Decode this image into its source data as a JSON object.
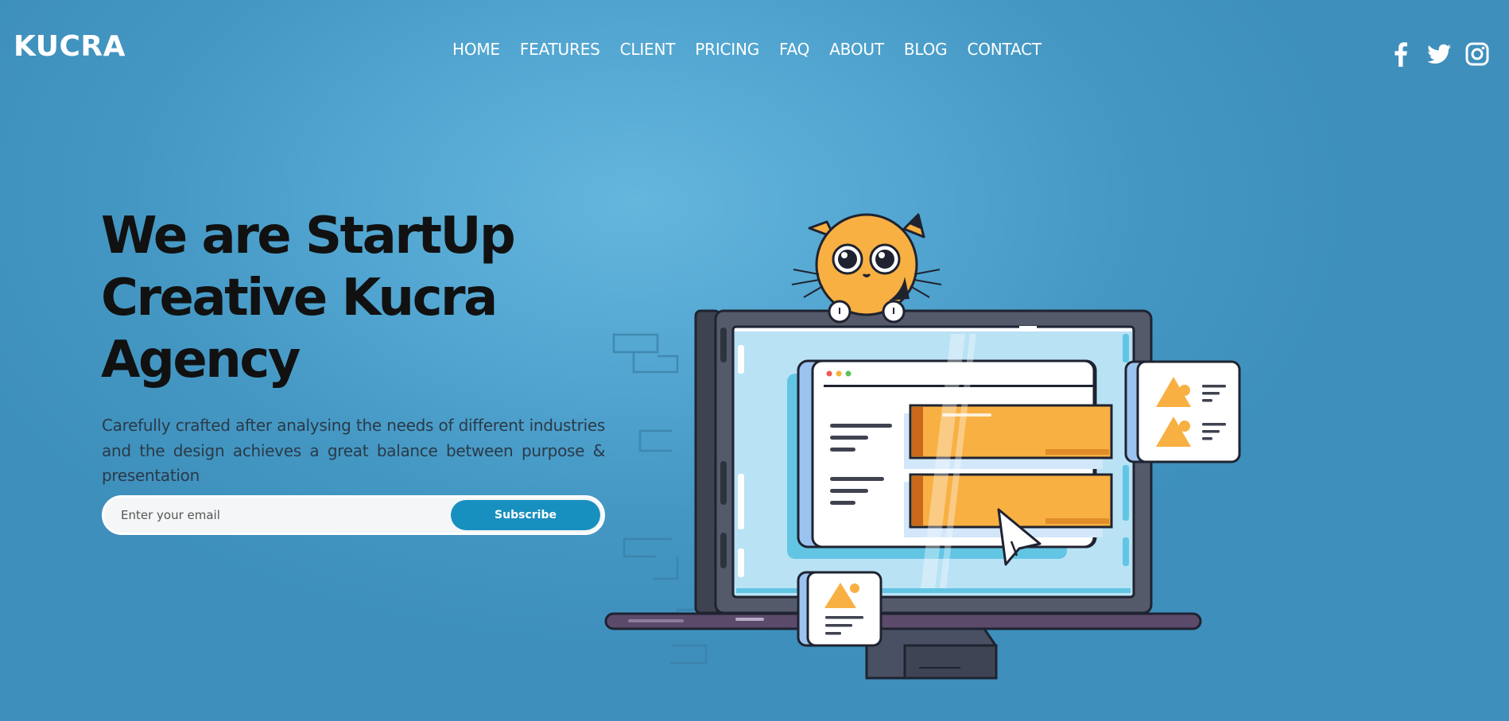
{
  "brand": {
    "name": "KUCRA"
  },
  "nav": {
    "items": [
      "HOME",
      "FEATURES",
      "CLIENT",
      "PRICING",
      "FAQ",
      "ABOUT",
      "BLOG",
      "CONTACT"
    ]
  },
  "social": [
    {
      "icon": "facebook-icon"
    },
    {
      "icon": "twitter-icon"
    },
    {
      "icon": "instagram-icon"
    }
  ],
  "hero": {
    "title_line1": "We are StartUp",
    "title_line2": "Creative Kucra",
    "title_line3": "Agency",
    "description": "Carefully crafted after analysing the needs of different industries and the design achieves a great balance between purpose & presentation"
  },
  "subscribe": {
    "placeholder": "Enter your email",
    "button_label": "Subscribe"
  },
  "colors": {
    "background": "#4fa3cf",
    "accent": "#1890bf",
    "illustration_orange": "#f8b042",
    "illustration_dark": "#3f4350"
  }
}
